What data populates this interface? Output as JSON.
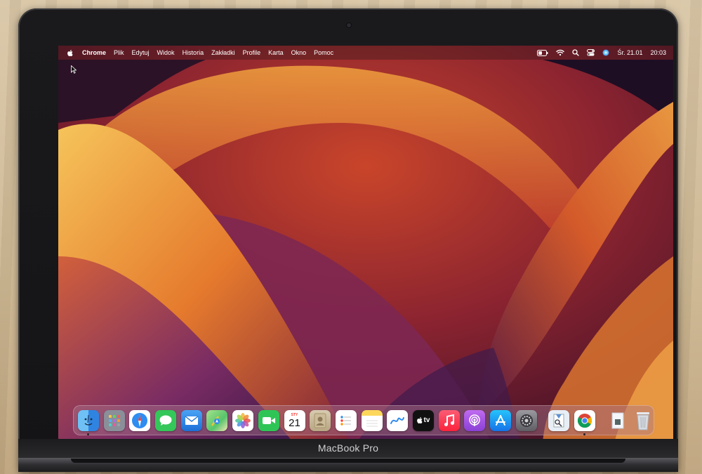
{
  "menubar": {
    "apple_icon": "apple-logo-icon",
    "app_name": "Chrome",
    "menus": [
      "Plik",
      "Edytuj",
      "Widok",
      "Historia",
      "Zakładki",
      "Profile",
      "Karta",
      "Okno",
      "Pomoc"
    ],
    "status_icons": [
      "battery-icon",
      "wifi-icon",
      "spotlight-search-icon",
      "control-center-icon",
      "siri-icon"
    ],
    "date": "Śr. 21.01",
    "time": "20:03"
  },
  "dock": {
    "apps": [
      {
        "name": "finder",
        "color": "#3a8ee6"
      },
      {
        "name": "launchpad",
        "color": "#8a8f99"
      },
      {
        "name": "safari",
        "color": "#2f8cf0"
      },
      {
        "name": "messages",
        "color": "#34c759"
      },
      {
        "name": "mail",
        "color": "#2a7de1"
      },
      {
        "name": "maps",
        "color": "#57c46b"
      },
      {
        "name": "photos",
        "color": "#ffffff"
      },
      {
        "name": "facetime",
        "color": "#2fc556"
      },
      {
        "name": "calendar",
        "color": "#ffffff",
        "month": "STY",
        "day": "21"
      },
      {
        "name": "contacts",
        "color": "#c9b99a"
      },
      {
        "name": "reminders",
        "color": "#ffffff"
      },
      {
        "name": "notes",
        "color": "#fdd75b"
      },
      {
        "name": "freeform",
        "color": "#ffffff"
      },
      {
        "name": "tv",
        "color": "#111111",
        "label": "tv"
      },
      {
        "name": "music",
        "color": "#fa3a55"
      },
      {
        "name": "podcasts",
        "color": "#9b4ee3"
      },
      {
        "name": "app-store",
        "color": "#1e8cf3"
      },
      {
        "name": "system-settings",
        "color": "#8e8e93"
      }
    ],
    "apps_after_separator": [
      {
        "name": "preview",
        "color": "#e8eef6"
      },
      {
        "name": "chrome",
        "color": "#ffffff"
      }
    ],
    "folders": [
      {
        "name": "downloads-stack",
        "color": "#e9eef4"
      },
      {
        "name": "trash",
        "color": "#d7dbe0"
      }
    ]
  },
  "hardware": {
    "model_label": "MacBook Pro"
  }
}
